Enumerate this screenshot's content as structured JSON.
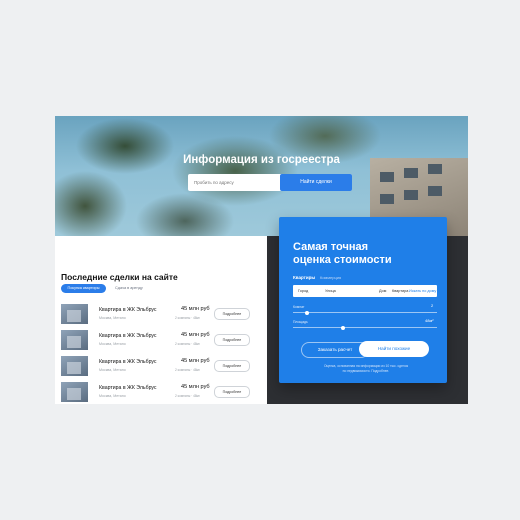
{
  "hero": {
    "title": "Информация из госреестра",
    "search_placeholder": "Пробить по адресу",
    "search_button": "Найти сделки"
  },
  "deals": {
    "title": "Последние сделки на сайте",
    "tabs": [
      {
        "label": "Покупка квартиры",
        "active": true
      },
      {
        "label": "Сдача в аренду",
        "active": false
      }
    ],
    "items": [
      {
        "title": "Квартира в ЖК Эльбрус",
        "address": "Москва, Метано",
        "price": "45 млн руб",
        "meta": "2 комнаты · 48м²",
        "button": "Подробнее"
      },
      {
        "title": "Квартира в ЖК Эльбрус",
        "address": "Москва, Метано",
        "price": "45 млн руб",
        "meta": "2 комнаты · 48м²",
        "button": "Подробнее"
      },
      {
        "title": "Квартира в ЖК Эльбрус",
        "address": "Москва, Метано",
        "price": "45 млн руб",
        "meta": "2 комнаты · 48м²",
        "button": "Подробнее"
      },
      {
        "title": "Квартира в ЖК Эльбрус",
        "address": "Москва, Метано",
        "price": "45 млн руб",
        "meta": "2 комнаты · 48м²",
        "button": "Подробнее"
      }
    ]
  },
  "estimate": {
    "title_line1": "Самая точная",
    "title_line2": "оценка стоимости",
    "tab_active": "Квартиры",
    "tab_inactive": "Коммерция",
    "fields": [
      "Город",
      "Улица",
      "Дом",
      "Квартира",
      "Искать по дому"
    ],
    "slider1_label": "Комнат",
    "slider1_value": "2",
    "slider1_fraction": 0.1,
    "slider2_label": "Площадь",
    "slider2_value": "48м²",
    "slider2_fraction": 0.35,
    "btn_calc": "Заказать расчет",
    "btn_find": "Найти похожие",
    "note_line1": "Оценка, основанная на информации из 10 тыс. сделок",
    "note_line2": "по недвижимости. Подробнее."
  },
  "colors": {
    "accent": "#2b7de9",
    "card": "#1f7fe8",
    "dark_band": "#2d2f33"
  }
}
